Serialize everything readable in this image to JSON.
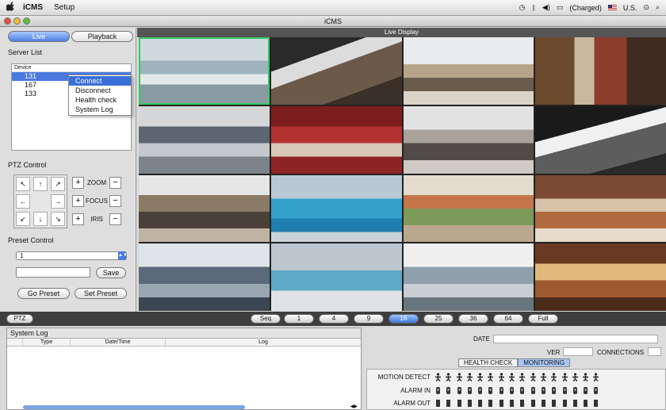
{
  "menubar": {
    "apple": "",
    "app_name": "iCMS",
    "menu_setup": "Setup",
    "battery": "(Charged)",
    "language": "U.S."
  },
  "window": {
    "title": "iCMS"
  },
  "left": {
    "tab_live": "Live",
    "tab_playback": "Playback",
    "server_list_label": "Server List",
    "device_header": "Device",
    "devices": [
      "131",
      "167",
      "133"
    ],
    "context_menu": [
      "Connect",
      "Disconnect",
      "Health check",
      "System Log"
    ],
    "ptz_label": "PTZ Control",
    "dpad": [
      "↖",
      "↑",
      "↗",
      "←",
      "",
      "→",
      "↙",
      "↓",
      "↘"
    ],
    "zoom": "ZOOM",
    "focus": "FOCUS",
    "iris": "IRIS",
    "plus": "+",
    "minus": "−",
    "preset_label": "Preset Control",
    "preset_value": "1",
    "save": "Save",
    "go_preset": "Go Preset",
    "set_preset": "Set Preset"
  },
  "live": {
    "title": "Live Display"
  },
  "bottombar": {
    "ptz": "PTZ",
    "splits": [
      "Seq",
      "1",
      "4",
      "9",
      "16",
      "25",
      "36",
      "64",
      "Full"
    ],
    "active_split": "16"
  },
  "syslog": {
    "title": "System Log",
    "col_type": "Type",
    "col_date": "Date/Time",
    "col_log": "Log"
  },
  "info": {
    "date_label": "DATE",
    "ver_label": "VER",
    "connections_label": "CONNECTIONS",
    "tab_health": "HEALTH CHECK",
    "tab_monitoring": "MONITORING",
    "motion": "MOTION DETECT",
    "alarm_in": "ALARM IN",
    "alarm_out": "ALARM OUT"
  },
  "colors": {
    "selection": "#4a7ae0",
    "grid_selected": "#33cc66"
  }
}
